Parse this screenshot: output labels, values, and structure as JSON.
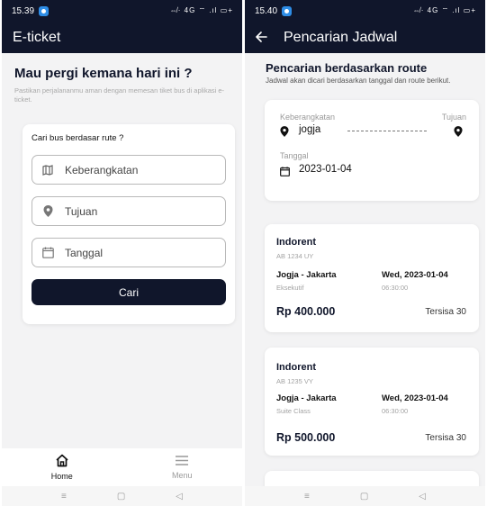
{
  "left": {
    "status": {
      "time": "15.39",
      "icons": "⇎· 4G ⌔ .ıl ▭+"
    },
    "appbar": {
      "title": "E-ticket"
    },
    "hero": {
      "heading": "Mau pergi kemana hari ini ?",
      "subtext": "Pastikan perjalananmu aman dengan memesan tiket bus di aplikasi e-ticket."
    },
    "form": {
      "label": "Cari bus berdasar rute ?",
      "departure_placeholder": "Keberangkatan",
      "destination_placeholder": "Tujuan",
      "date_placeholder": "Tanggal",
      "submit_label": "Cari"
    },
    "nav": {
      "home_label": "Home",
      "menu_label": "Menu"
    }
  },
  "right": {
    "status": {
      "time": "15.40",
      "icons": "⇎· 4G ⌔ .ıl ▭+"
    },
    "appbar": {
      "title": "Pencarian Jadwal"
    },
    "section": {
      "title": "Pencarian berdasarkan route",
      "subtitle": "Jadwal akan dicari berdasarkan tanggal dan route berikut."
    },
    "route": {
      "departure_label": "Keberangkatan",
      "departure_value": "jogja",
      "destination_label": "Tujuan",
      "date_label": "Tanggal",
      "date_value": "2023-01-04"
    },
    "results": [
      {
        "operator": "Indorent",
        "code": "AB 1234 UY",
        "route": "Jogja - Jakarta",
        "class": "Eksekutif",
        "date": "Wed, 2023-01-04",
        "time": "06:30:00",
        "price": "Rp 400.000",
        "remaining": "Tersisa 30"
      },
      {
        "operator": "Indorent",
        "code": "AB 1235 VY",
        "route": "Jogja - Jakarta",
        "class": "Suite Class",
        "date": "Wed, 2023-01-04",
        "time": "06:30:00",
        "price": "Rp 500.000",
        "remaining": "Tersisa 30"
      }
    ]
  },
  "system_nav": {
    "menu": "≡",
    "home": "▢",
    "back": "◁"
  },
  "colors": {
    "primary": "#10162b",
    "background": "#f3f3f4",
    "card": "#ffffff",
    "muted": "#a3a3a3"
  }
}
